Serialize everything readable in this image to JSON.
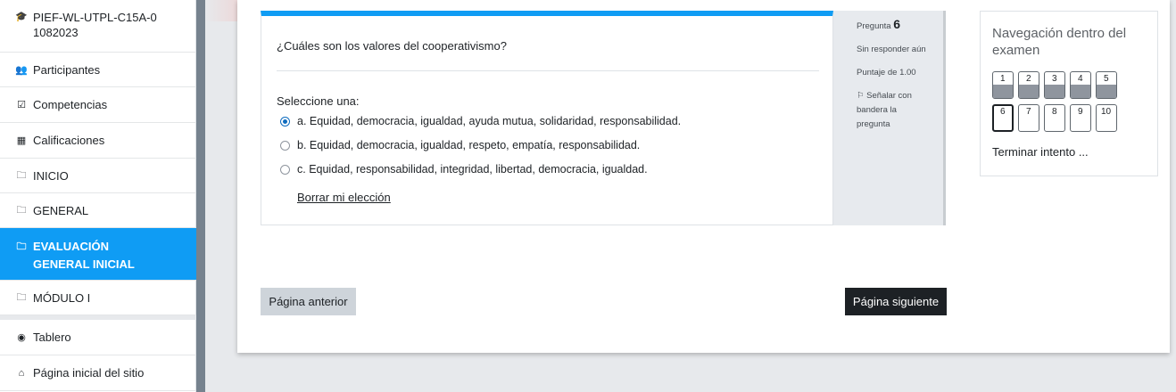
{
  "sidebar": {
    "items": [
      {
        "icon": "graduation-cap-icon",
        "glyph": "🎓",
        "label": "PIEF-WL-UTPL-C15A-01082023",
        "active": false
      },
      {
        "icon": "users-icon",
        "glyph": "👥",
        "label": "Participantes",
        "active": false
      },
      {
        "icon": "checkbox-icon",
        "glyph": "☑",
        "label": "Competencias",
        "active": false
      },
      {
        "icon": "table-icon",
        "glyph": "▦",
        "label": "Calificaciones",
        "active": false
      },
      {
        "icon": "folder-icon",
        "glyph": "🗀",
        "label": "INICIO",
        "active": false
      },
      {
        "icon": "folder-icon",
        "glyph": "🗀",
        "label": "GENERAL",
        "active": false
      },
      {
        "icon": "folder-icon",
        "glyph": "🗀",
        "label": "EVALUACIÓN GENERAL INICIAL",
        "active": true
      },
      {
        "icon": "folder-icon",
        "glyph": "🗀",
        "label": "MÓDULO I",
        "active": false
      },
      {
        "icon": "dashboard-icon",
        "glyph": "◉",
        "label": "Tablero",
        "active": false
      },
      {
        "icon": "home-icon",
        "glyph": "⌂",
        "label": "Página inicial del sitio",
        "active": false
      }
    ]
  },
  "question": {
    "number_label": "Pregunta",
    "number": "6",
    "status": "Sin responder aún",
    "score": "Puntaje de 1.00",
    "flag_label": "Señalar con bandera la pregunta",
    "text": "¿Cuáles son los valores del cooperativismo?",
    "prompt": "Seleccione una:",
    "options": [
      {
        "label": "a. Equidad, democracia, igualdad, ayuda mutua, solidaridad, responsabilidad.",
        "selected": true
      },
      {
        "label": "b. Equidad, democracia, igualdad, respeto, empatía, responsabilidad.",
        "selected": false
      },
      {
        "label": "c. Equidad, responsabilidad, integridad, libertad, democracia, igualdad.",
        "selected": false
      }
    ],
    "clear_label": "Borrar mi elección"
  },
  "buttons": {
    "prev": "Página anterior",
    "next": "Página siguiente"
  },
  "quiz_nav": {
    "title": "Navegación dentro del examen",
    "questions": [
      {
        "n": "1",
        "state": "answered"
      },
      {
        "n": "2",
        "state": "answered"
      },
      {
        "n": "3",
        "state": "answered"
      },
      {
        "n": "4",
        "state": "answered"
      },
      {
        "n": "5",
        "state": "answered"
      },
      {
        "n": "6",
        "state": "current"
      },
      {
        "n": "7",
        "state": "unanswered"
      },
      {
        "n": "8",
        "state": "unanswered"
      },
      {
        "n": "9",
        "state": "unanswered"
      },
      {
        "n": "10",
        "state": "unanswered"
      }
    ],
    "finish_label": "Terminar intento ..."
  }
}
